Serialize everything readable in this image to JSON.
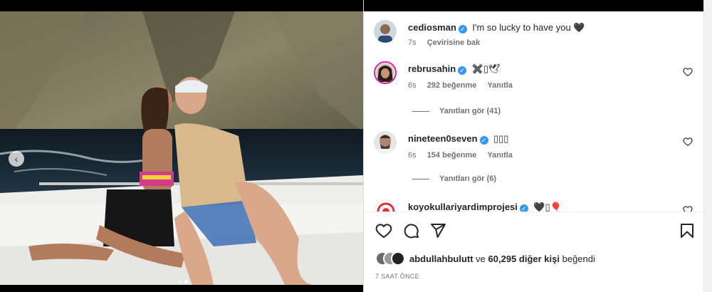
{
  "post": {
    "author": "cediosman",
    "caption": "I'm so lucky to have you 🖤",
    "caption_age": "7s",
    "translate_label": "Çevirisine bak",
    "carousel_prev": "‹"
  },
  "comments": [
    {
      "username": "rebrusahin",
      "text": "✖️▯🕊",
      "age": "6s",
      "likes": "292 beğenme",
      "reply_label": "Yanıtla",
      "view_replies": "Yanıtları gör (41)"
    },
    {
      "username": "nineteen0seven",
      "text": "▯▯▯",
      "age": "6s",
      "likes": "154 beğenme",
      "reply_label": "Yanıtla",
      "view_replies": "Yanıtları gör (6)"
    },
    {
      "username": "koyokullariyardimprojesi",
      "text": "🖤▯🎈"
    }
  ],
  "likes_summary": {
    "user": "abdullahbulutt",
    "connector": "ve",
    "others": "60,295 diğer kişi",
    "suffix": "beğendi"
  },
  "posted_time": "7 SAAT ÖNCE",
  "colors": {
    "verified": "#3897f0",
    "text": "#262626",
    "muted": "#737373"
  },
  "icons": [
    "heart-icon",
    "comment-icon",
    "share-icon",
    "bookmark-icon",
    "verified-icon",
    "chevron-left-icon"
  ]
}
